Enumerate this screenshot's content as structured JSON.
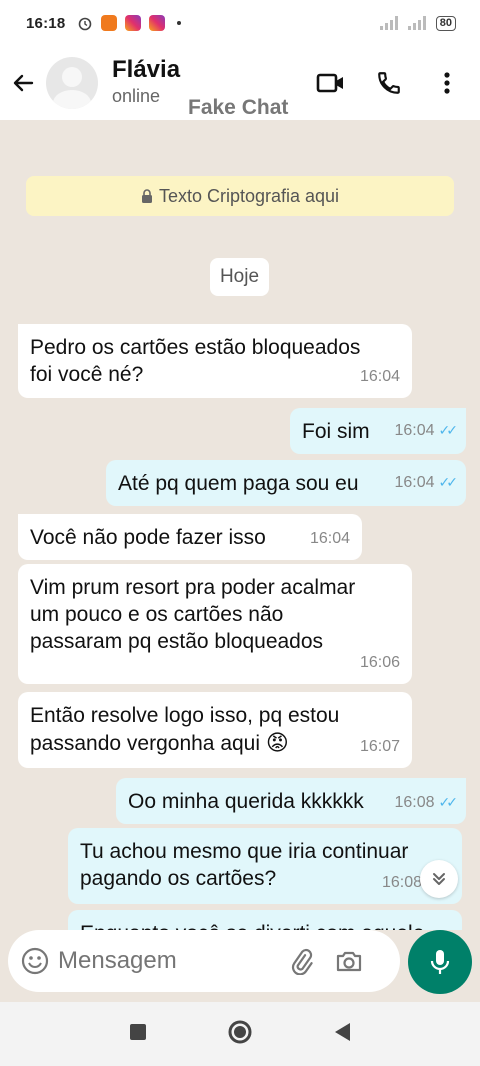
{
  "status_bar": {
    "time": "16:18",
    "battery": "80"
  },
  "header": {
    "contact_name": "Flávia",
    "contact_status": "online",
    "watermark": "Fake Chat"
  },
  "encryption_notice": "Texto Criptografia aqui",
  "date_chip": "Hoje",
  "messages": [
    {
      "direction": "in",
      "text_lines": [
        "Pedro os cartões estão bloqueados",
        "foi você né?"
      ],
      "time": "16:04"
    },
    {
      "direction": "out",
      "text_lines": [
        "Foi sim"
      ],
      "time": "16:04",
      "read": true
    },
    {
      "direction": "out",
      "text_lines": [
        "Até pq quem paga sou eu"
      ],
      "time": "16:04",
      "read": true
    },
    {
      "direction": "in",
      "text_lines": [
        "Você não pode fazer isso"
      ],
      "time": "16:04"
    },
    {
      "direction": "in",
      "text_lines": [
        "Vim prum resort pra poder acalmar",
        "um pouco e os cartões não",
        "passaram pq estão bloqueados"
      ],
      "time": "16:06"
    },
    {
      "direction": "in",
      "text_lines": [
        "Então resolve logo isso, pq  estou",
        "passando vergonha aqui"
      ],
      "emoji": "😡",
      "time": "16:07"
    },
    {
      "direction": "out",
      "text_lines": [
        "Oo minha querida kkkkkk"
      ],
      "time": "16:08",
      "read": true
    },
    {
      "direction": "out",
      "text_lines": [
        "Tu achou mesmo que iria continuar",
        "pagando os cartões?"
      ],
      "time": "16:08"
    },
    {
      "direction": "out",
      "text_lines": [
        "Enquanto você se diverti com aquele"
      ],
      "time": ""
    }
  ],
  "composer": {
    "placeholder": "Mensagem"
  },
  "icons": {
    "back": "arrow-left-icon",
    "video": "video-call-icon",
    "phone": "phone-icon",
    "menu": "more-vert-icon",
    "lock": "lock-icon",
    "emoji": "emoji-icon",
    "attach": "paperclip-icon",
    "camera": "camera-icon",
    "mic": "mic-icon",
    "scroll": "double-chevron-down-icon"
  },
  "colors": {
    "accent": "#008069",
    "outgoing_bubble": "#e1f7fb",
    "incoming_bubble": "#ffffff",
    "read_ticks": "#4fb6ec",
    "notice_bg": "#fcf4c4"
  }
}
